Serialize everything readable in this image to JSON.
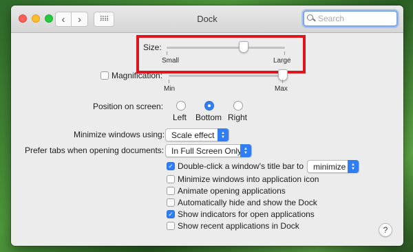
{
  "window": {
    "title": "Dock",
    "search_placeholder": "Search"
  },
  "size": {
    "label": "Size:",
    "min_label": "Small",
    "max_label": "Large",
    "value_fraction": 0.65
  },
  "magnification": {
    "label": "Magnification:",
    "checked": false,
    "min_label": "Min",
    "max_label": "Max",
    "value_fraction": 1.0
  },
  "position": {
    "label": "Position on screen:",
    "options": [
      "Left",
      "Bottom",
      "Right"
    ],
    "selected": "Bottom"
  },
  "minimize": {
    "label": "Minimize windows using:",
    "value": "Scale effect"
  },
  "prefer_tabs": {
    "label": "Prefer tabs when opening documents:",
    "value": "In Full Screen Only"
  },
  "double_click": {
    "label": "Double-click a window's title bar to",
    "checked": true,
    "value": "minimize"
  },
  "checkboxes": [
    {
      "label": "Minimize windows into application icon",
      "checked": false
    },
    {
      "label": "Animate opening applications",
      "checked": false
    },
    {
      "label": "Automatically hide and show the Dock",
      "checked": false
    },
    {
      "label": "Show indicators for open applications",
      "checked": true
    },
    {
      "label": "Show recent applications in Dock",
      "checked": false
    }
  ],
  "help_label": "?",
  "colors": {
    "accent": "#2f7ef6",
    "highlight": "#e0141e"
  }
}
